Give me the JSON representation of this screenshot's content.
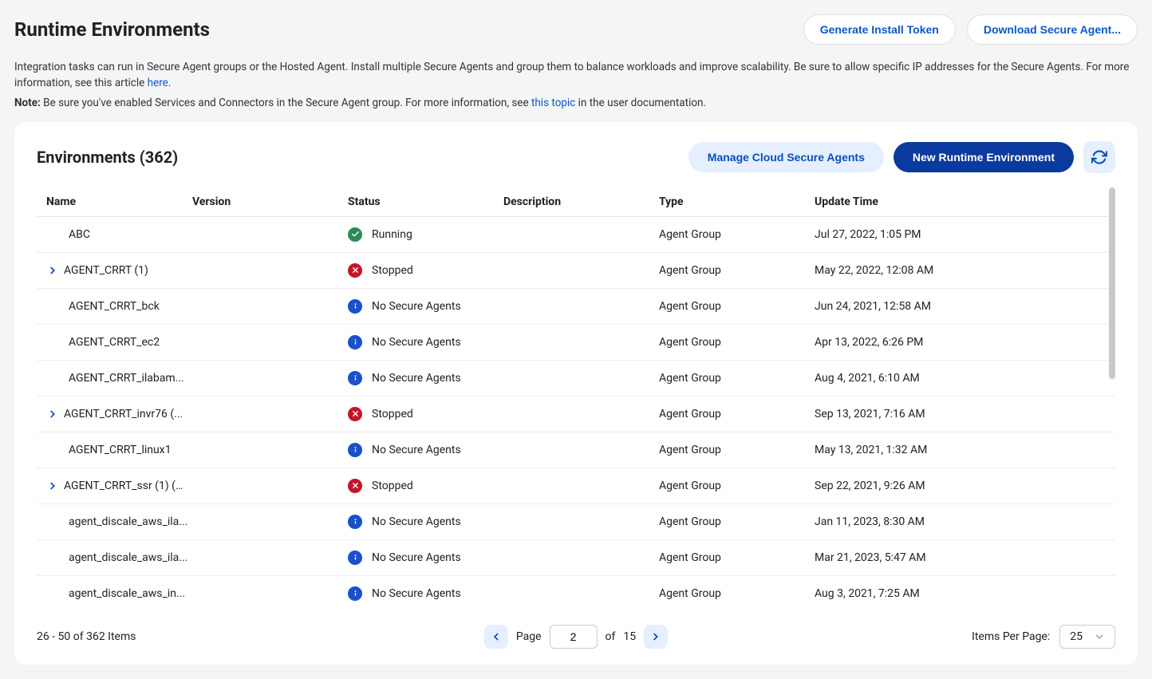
{
  "page": {
    "title": "Runtime Environments",
    "generate_token": "Generate Install Token",
    "download_agent": "Download Secure Agent...",
    "info_text_1_pre": "Integration tasks can run in Secure Agent groups or the Hosted Agent. Install multiple Secure Agents and group them to balance workloads and improve scalability. Be sure to allow specific IP addresses for the Secure Agents. For more information, see this article ",
    "info_link_1": "here",
    "info_text_1_post": ".",
    "note_label": "Note:",
    "info_text_2_pre": " Be sure you've enabled Services and Connectors in the Secure Agent group. For more information, see ",
    "info_link_2": "this topic",
    "info_text_2_post": " in the user documentation."
  },
  "card": {
    "title": "Environments (362)",
    "manage_label": "Manage Cloud Secure Agents",
    "new_label": "New Runtime Environment"
  },
  "columns": {
    "name": "Name",
    "version": "Version",
    "status": "Status",
    "desc": "Description",
    "type": "Type",
    "time": "Update Time"
  },
  "rows": [
    {
      "name": "ABC",
      "expandable": false,
      "status": "Running",
      "status_kind": "running",
      "type": "Agent Group",
      "time": "Jul 27, 2022, 1:05 PM"
    },
    {
      "name": "AGENT_CRRT (1)",
      "expandable": true,
      "status": "Stopped",
      "status_kind": "stopped",
      "type": "Agent Group",
      "time": "May 22, 2022, 12:08 AM"
    },
    {
      "name": "AGENT_CRRT_bck",
      "expandable": false,
      "status": "No Secure Agents",
      "status_kind": "info",
      "type": "Agent Group",
      "time": "Jun 24, 2021, 12:58 AM"
    },
    {
      "name": "AGENT_CRRT_ec2",
      "expandable": false,
      "status": "No Secure Agents",
      "status_kind": "info",
      "type": "Agent Group",
      "time": "Apr 13, 2022, 6:26 PM"
    },
    {
      "name": "AGENT_CRRT_ilabam...",
      "expandable": false,
      "status": "No Secure Agents",
      "status_kind": "info",
      "type": "Agent Group",
      "time": "Aug 4, 2021, 6:10 AM"
    },
    {
      "name": "AGENT_CRRT_invr76 (...",
      "expandable": true,
      "status": "Stopped",
      "status_kind": "stopped",
      "type": "Agent Group",
      "time": "Sep 13, 2021, 7:16 AM"
    },
    {
      "name": "AGENT_CRRT_linux1",
      "expandable": false,
      "status": "No Secure Agents",
      "status_kind": "info",
      "type": "Agent Group",
      "time": "May 13, 2021, 1:32 AM"
    },
    {
      "name": "AGENT_CRRT_ssr (1) (...",
      "expandable": true,
      "status": "Stopped",
      "status_kind": "stopped",
      "type": "Agent Group",
      "time": "Sep 22, 2021, 9:26 AM"
    },
    {
      "name": "agent_discale_aws_ila...",
      "expandable": false,
      "status": "No Secure Agents",
      "status_kind": "info",
      "type": "Agent Group",
      "time": "Jan 11, 2023, 8:30 AM"
    },
    {
      "name": "agent_discale_aws_ila...",
      "expandable": false,
      "status": "No Secure Agents",
      "status_kind": "info",
      "type": "Agent Group",
      "time": "Mar 21, 2023, 5:47 AM"
    },
    {
      "name": "agent_discale_aws_in...",
      "expandable": false,
      "status": "No Secure Agents",
      "status_kind": "info",
      "type": "Agent Group",
      "time": "Aug 3, 2021, 7:25 AM"
    }
  ],
  "footer": {
    "range": "26 - 50 of 362 Items",
    "page_label": "Page",
    "page_value": "2",
    "of_label": "of",
    "total_pages": "15",
    "per_page_label": "Items Per Page:",
    "per_page_value": "25"
  }
}
